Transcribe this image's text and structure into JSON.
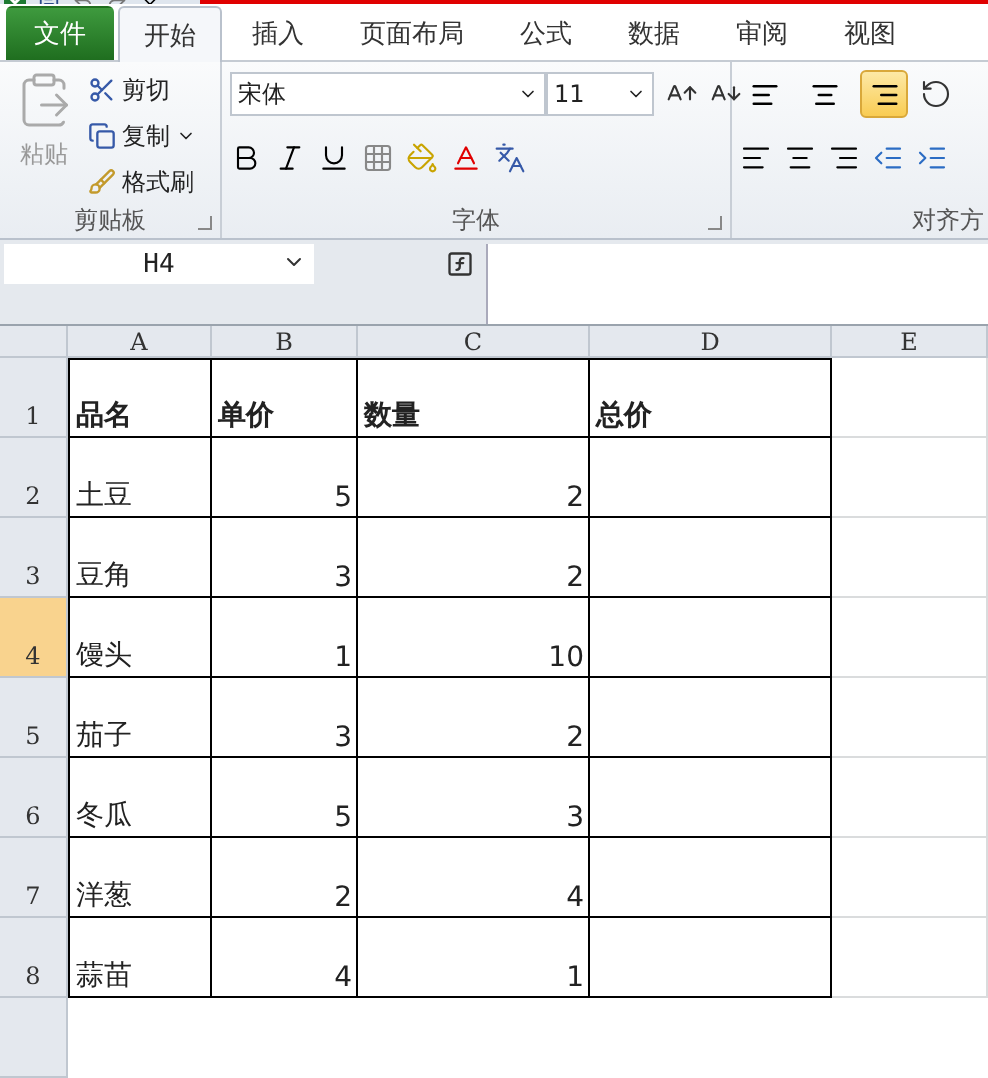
{
  "tabs": [
    {
      "label": "文件",
      "kind": "file",
      "selected": false
    },
    {
      "label": "开始",
      "kind": "normal",
      "selected": true
    },
    {
      "label": "插入",
      "kind": "normal",
      "selected": false
    },
    {
      "label": "页面布局",
      "kind": "normal",
      "selected": false
    },
    {
      "label": "公式",
      "kind": "normal",
      "selected": false
    },
    {
      "label": "数据",
      "kind": "normal",
      "selected": false
    },
    {
      "label": "审阅",
      "kind": "normal",
      "selected": false
    },
    {
      "label": "视图",
      "kind": "normal",
      "selected": false
    }
  ],
  "clipboard": {
    "paste": "粘贴",
    "cut": "剪切",
    "copy": "复制",
    "format_painter": "格式刷",
    "label": "剪贴板"
  },
  "font": {
    "name": "宋体",
    "size": "11",
    "label": "字体"
  },
  "alignment": {
    "label": "对齐方",
    "vertical": [
      {
        "kind": "top",
        "selected": false
      },
      {
        "kind": "middle",
        "selected": false
      },
      {
        "kind": "bottom",
        "selected": true
      }
    ]
  },
  "name_box": "H4",
  "columns": [
    "A",
    "B",
    "C",
    "D",
    "E"
  ],
  "rows": [
    {
      "number": "1",
      "selected": false,
      "cells": [
        "品名",
        "单价",
        "数量",
        "总价"
      ]
    },
    {
      "number": "2",
      "selected": false,
      "cells": [
        "土豆",
        "5",
        "2",
        ""
      ]
    },
    {
      "number": "3",
      "selected": false,
      "cells": [
        "豆角",
        "3",
        "2",
        ""
      ]
    },
    {
      "number": "4",
      "selected": true,
      "cells": [
        "馒头",
        "1",
        "10",
        ""
      ]
    },
    {
      "number": "5",
      "selected": false,
      "cells": [
        "茄子",
        "3",
        "2",
        ""
      ]
    },
    {
      "number": "6",
      "selected": false,
      "cells": [
        "冬瓜",
        "5",
        "3",
        ""
      ]
    },
    {
      "number": "7",
      "selected": false,
      "cells": [
        "洋葱",
        "2",
        "4",
        ""
      ]
    },
    {
      "number": "8",
      "selected": false,
      "cells": [
        "蒜苗",
        "4",
        "1",
        ""
      ]
    }
  ]
}
